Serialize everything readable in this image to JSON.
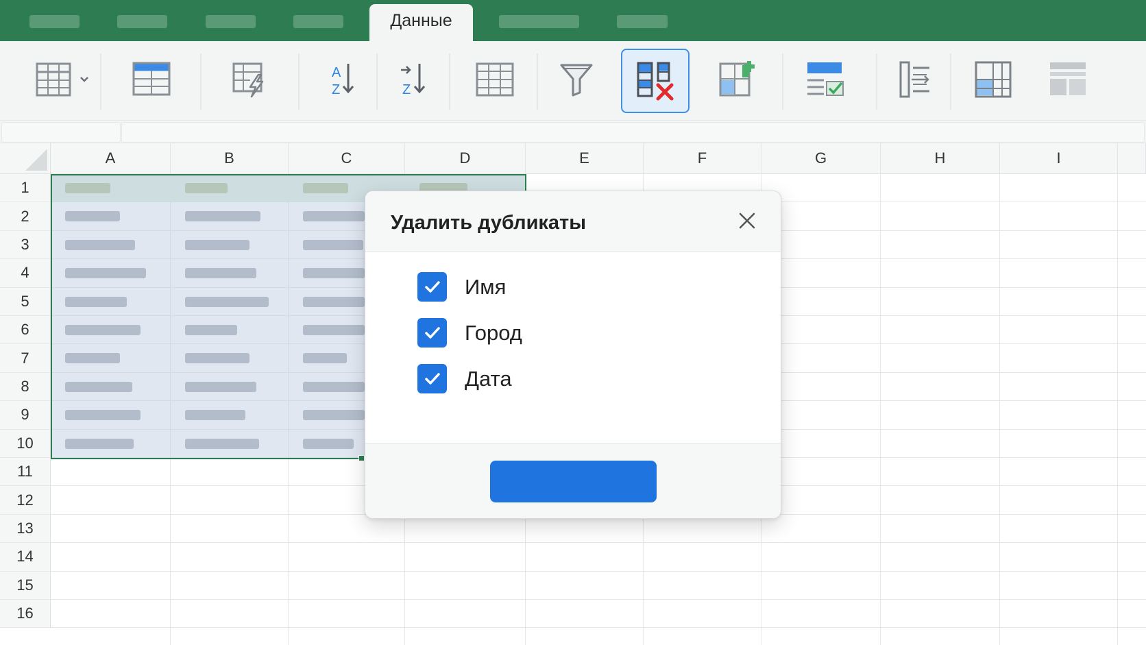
{
  "ribbon_tabs": {
    "active_label": "Данные"
  },
  "columns": [
    "A",
    "B",
    "C",
    "D",
    "E",
    "F",
    "G",
    "H",
    "I"
  ],
  "rows": [
    "1",
    "2",
    "3",
    "4",
    "5",
    "6",
    "7",
    "8",
    "9",
    "10",
    "11",
    "12",
    "13",
    "14",
    "15",
    "16"
  ],
  "dialog": {
    "title": "Удалить дубликаты",
    "columns": [
      {
        "label": "Имя",
        "checked": true
      },
      {
        "label": "Город",
        "checked": true
      },
      {
        "label": "Дата",
        "checked": true
      }
    ],
    "ok_label": ""
  },
  "colors": {
    "app_green": "#2e7d52",
    "accent_blue": "#1f74e0",
    "selection_fill": "#bccde2"
  }
}
